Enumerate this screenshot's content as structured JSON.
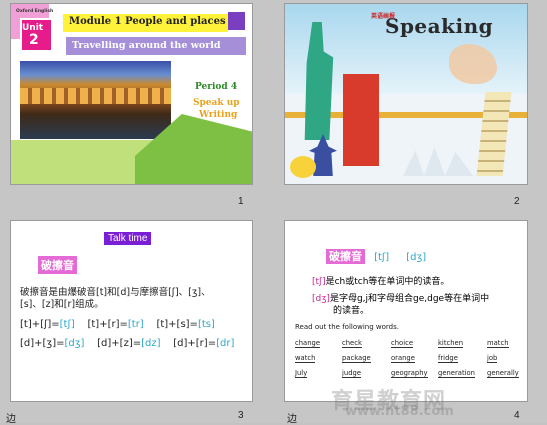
{
  "slides": {
    "s1": {
      "number": "1",
      "oxford": "Oxford English",
      "unit_label": "Unit",
      "unit_number": "2",
      "title": "Module 1  People and places",
      "subtitle": "Travelling around the world",
      "period": "Period 4",
      "speak_up": "Speak up",
      "writing": "Writing"
    },
    "s2": {
      "number": "2",
      "title": "Speaking",
      "logo": "英语画报"
    },
    "s3": {
      "number": "3",
      "talk_time": "Talk time",
      "heading": "破擦音",
      "line1": "破擦音是由爆破音[t]和[d]与摩擦音[ʃ]、[ʒ]、",
      "line2": "[s]、[z]和[r]组成。",
      "f1a": "[t]+[ʃ]=",
      "f1b": "[tʃ]",
      "f2a": "[t]+[r]=",
      "f2b": "[tr]",
      "f3a": "[t]+[s]=",
      "f3b": "[ts]",
      "f4a": "[d]+[ʒ]=",
      "f4b": "[dʒ]",
      "f5a": "[d]+[z]=",
      "f5b": "[dz]",
      "f6a": "[d]+[r]=",
      "f6b": "[dr]"
    },
    "s4": {
      "number": "4",
      "heading": "破擦音",
      "h_ph1": "[tʃ]",
      "h_ph2": "[dʒ]",
      "r1_ph": "[tʃ]",
      "r1_text": "是ch或tch等在单词中的读音。",
      "r2_ph": "[dʒ]",
      "r2_text1": "是字母g,j和字母组合ge,dge等在单词中",
      "r2_text2": "的读音。",
      "instruction": "Read out the following words.",
      "words": [
        [
          "change",
          "check",
          "choice",
          "kitchen",
          "match"
        ],
        [
          "watch",
          "package",
          "orange",
          "fridge",
          "job"
        ],
        [
          "July",
          "judge",
          "geography",
          "generation",
          "generally"
        ]
      ]
    }
  },
  "footer_chars": {
    "left3": "边",
    "left4": "边"
  },
  "watermark": {
    "line1": "育星教育网",
    "line2": "www.ht88.com"
  }
}
